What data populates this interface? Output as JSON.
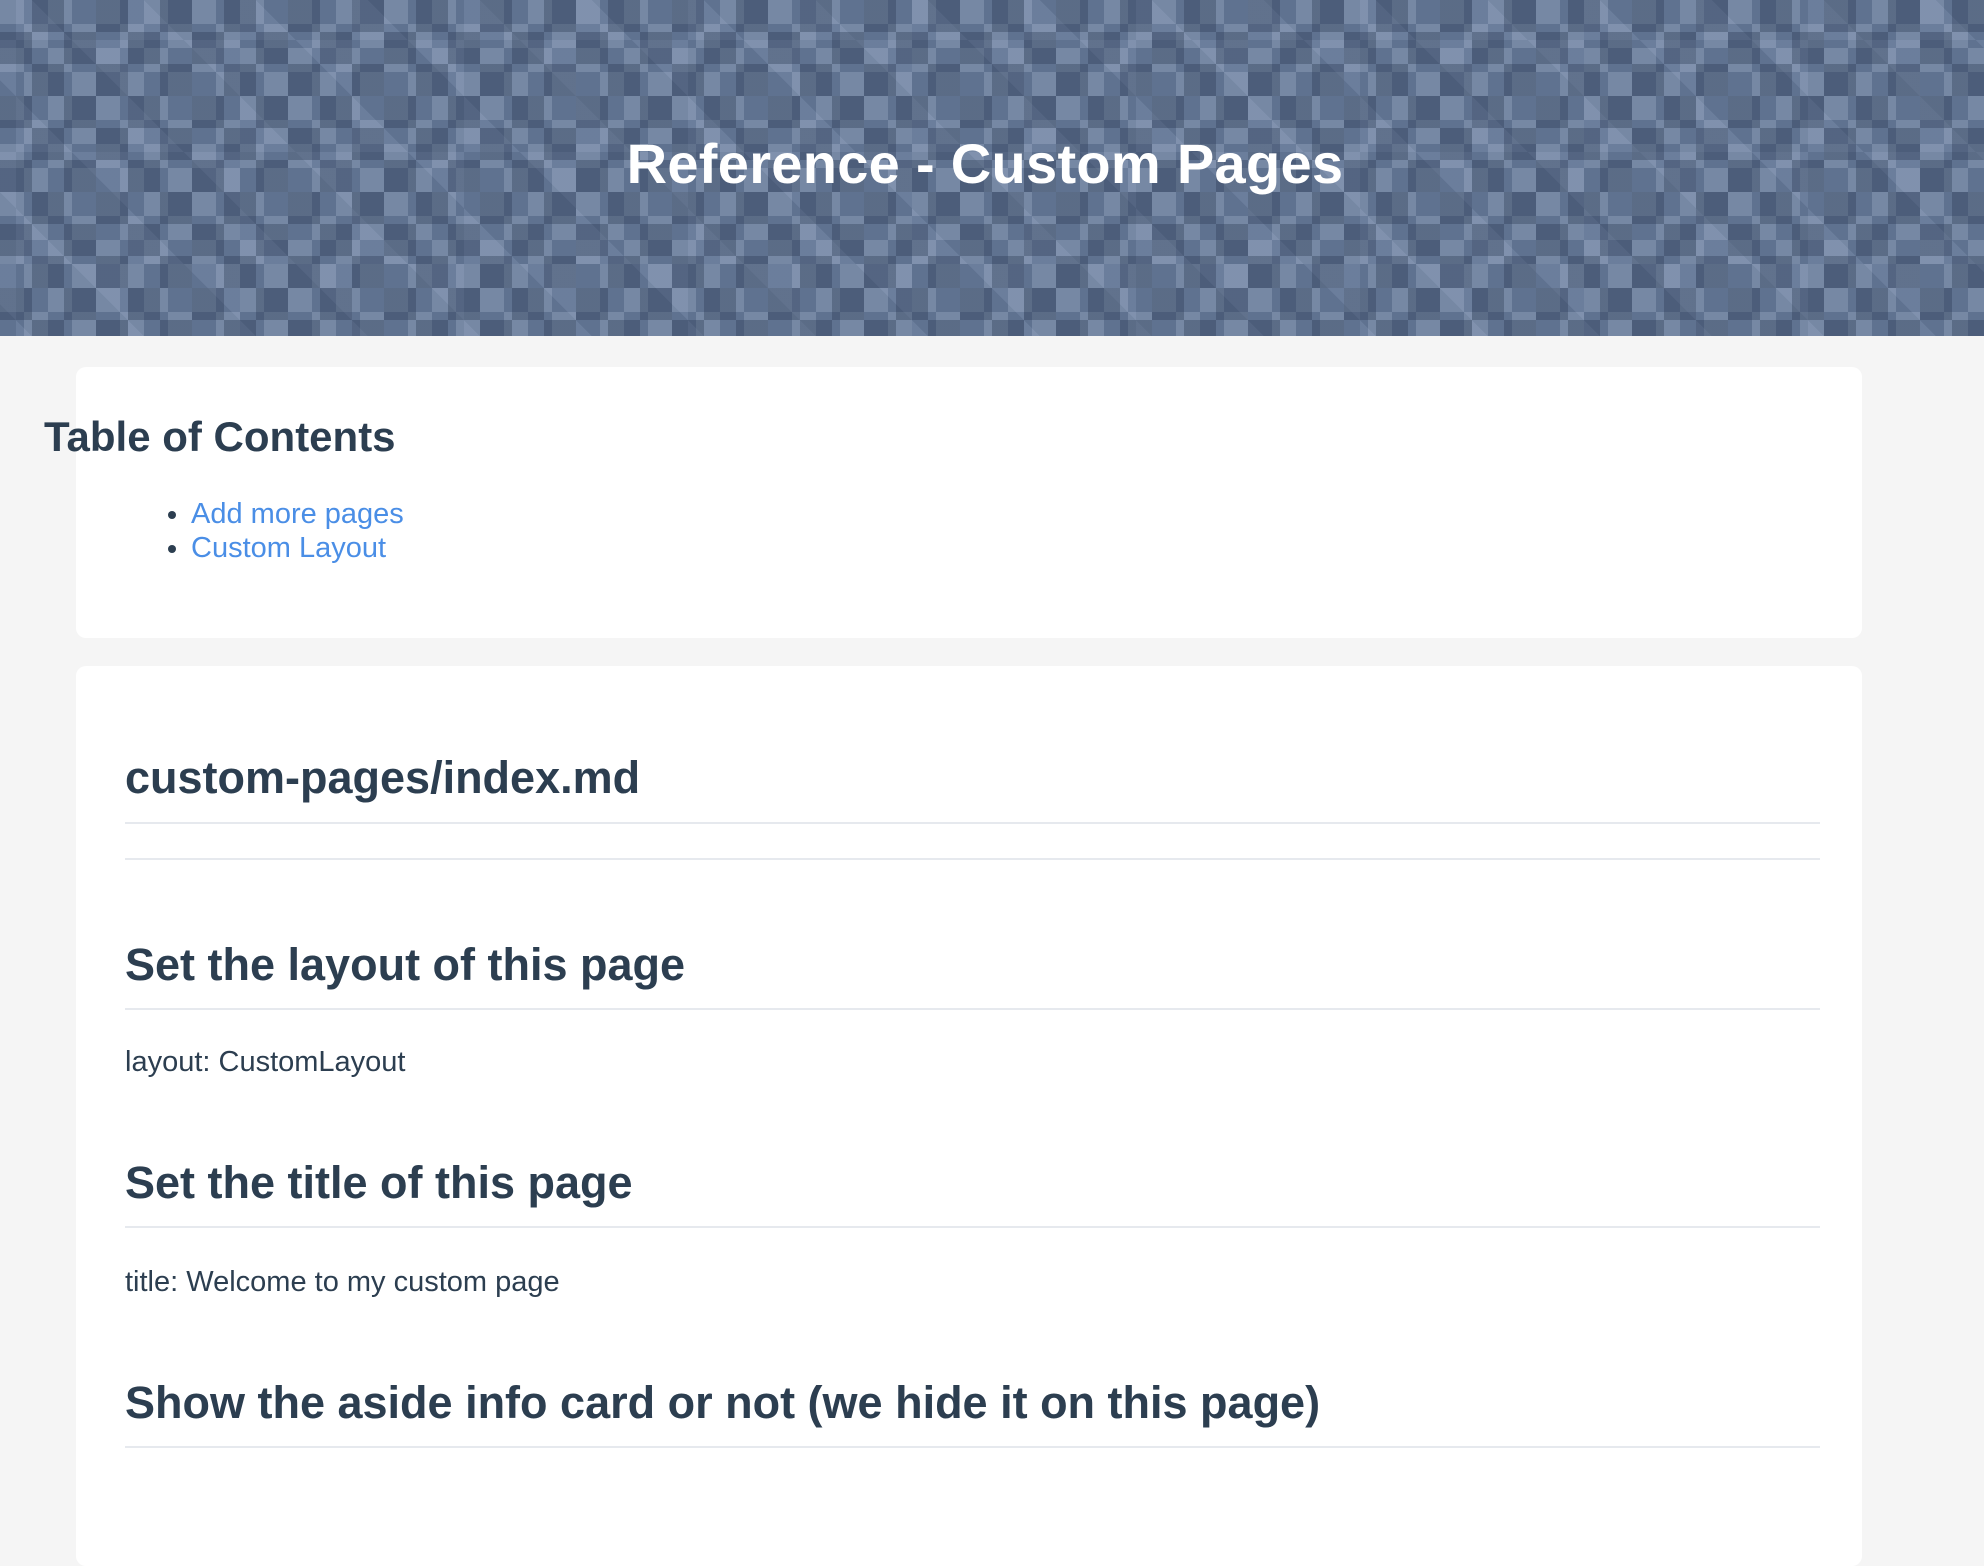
{
  "header": {
    "title": "Reference - Custom Pages"
  },
  "toc": {
    "title": "Table of Contents",
    "items": [
      {
        "label": "Add more pages"
      },
      {
        "label": "Custom Layout"
      }
    ]
  },
  "content": {
    "file_heading": "custom-pages/index.md",
    "sections": [
      {
        "heading": "Set the layout of this page",
        "text": "layout: CustomLayout"
      },
      {
        "heading": "Set the title of this page",
        "text": "title: Welcome to my custom page"
      },
      {
        "heading": "Show the aside info card or not (we hide it on this page)",
        "text": ""
      }
    ]
  },
  "colors": {
    "link": "#4a8ee6",
    "text": "#2c3e50",
    "page_background": "#f5f5f5",
    "hero_background": "#5f7290"
  }
}
